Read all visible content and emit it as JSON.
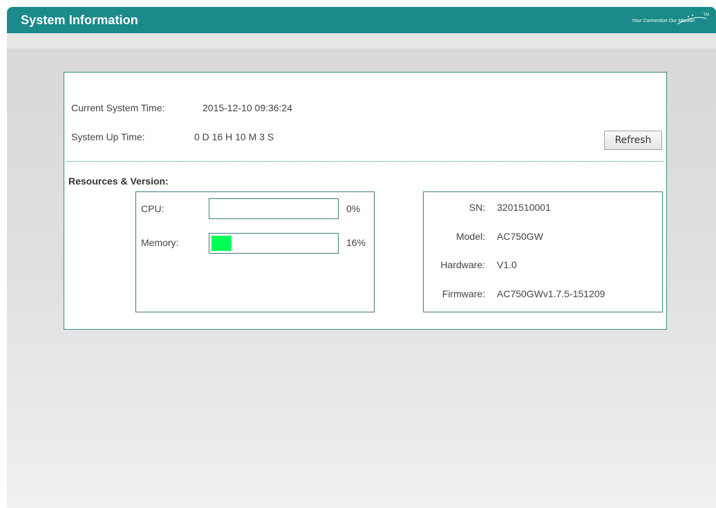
{
  "header": {
    "title": "System Information",
    "logo_text": "Your Connection  Our Mission",
    "logo_tm": "TM"
  },
  "system": {
    "time_label": "Current System Time:",
    "time_value": "2015-12-10 09:36:24",
    "uptime_label": "System Up Time:",
    "uptime_value": "0 D 16 H 10 M 3 S",
    "refresh_label": "Refresh"
  },
  "resources": {
    "title": "Resources & Version:",
    "cpu_label": "CPU:",
    "cpu_value": "0%",
    "cpu_percent": 0,
    "memory_label": "Memory:",
    "memory_value": "16%",
    "memory_percent": 16
  },
  "version": {
    "sn_label": "SN:",
    "sn_value": "3201510001",
    "model_label": "Model:",
    "model_value": "AC750GW",
    "hardware_label": "Hardware:",
    "hardware_value": "V1.0",
    "firmware_label": "Firmware:",
    "firmware_value": "AC750GWv1.7.5-151209"
  },
  "colors": {
    "header_bg": "#1a8a8a",
    "border": "#3b7b7b",
    "memory_fill": "#00ff55"
  }
}
